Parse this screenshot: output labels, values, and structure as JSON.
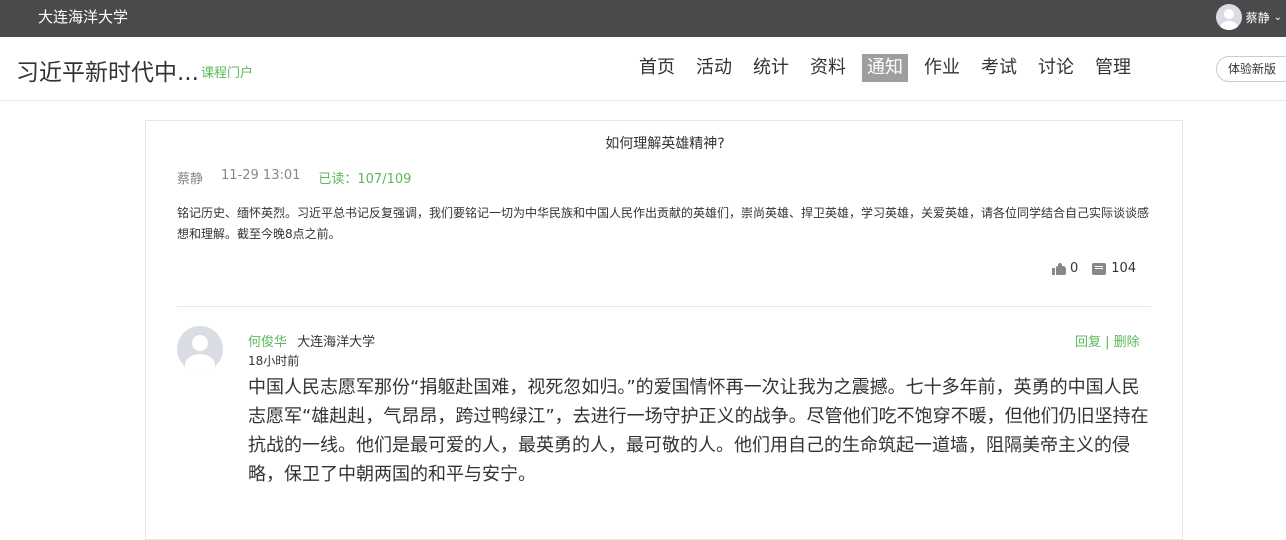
{
  "topbar": {
    "school_name": "大连海洋大学",
    "user_name": "蔡静",
    "dropdown_glyph": "⌄"
  },
  "nav": {
    "course_title": "习近平新时代中...",
    "course_portal": "课程门户",
    "menu": [
      {
        "label": "首页",
        "active": false
      },
      {
        "label": "活动",
        "active": false
      },
      {
        "label": "统计",
        "active": false
      },
      {
        "label": "资料",
        "active": false
      },
      {
        "label": "通知",
        "active": true
      },
      {
        "label": "作业",
        "active": false
      },
      {
        "label": "考试",
        "active": false
      },
      {
        "label": "讨论",
        "active": false
      },
      {
        "label": "管理",
        "active": false
      }
    ],
    "trial_button": "体验新版"
  },
  "notice": {
    "title": "如何理解英雄精神?",
    "author": "蔡静",
    "time": "11-29 13:01",
    "read_status": "已读：107/109",
    "body": "铭记历史、缅怀英烈。习近平总书记反复强调，我们要铭记一切为中华民族和中国人民作出贡献的英雄们，崇尚英雄、捍卫英雄，学习英雄，关爱英雄，请各位同学结合自己实际谈谈感想和理解。截至今晚8点之前。",
    "likes": "0",
    "comments": "104"
  },
  "reply": {
    "author": "何俊华",
    "school": "大连海洋大学",
    "time": "18小时前",
    "actions": "回复 | 删除",
    "text": "中国人民志愿军那份“捐躯赴国难，视死忽如归。”的爱国情怀再一次让我为之震撼。七十多年前，英勇的中国人民志愿军“雄赳赳，气昂昂，跨过鸭绿江”，去进行一场守护正义的战争。尽管他们吃不饱穿不暖，但他们仍旧坚持在抗战的一线。他们是最可爱的人，最英勇的人，最可敬的人。他们用自己的生命筑起一道墙，阻隔美帝主义的侵略，保卫了中朝两国的和平与安宁。"
  },
  "colors": {
    "topbar": "#4a4a4a",
    "accent_green": "#5cb85c",
    "active_tab": "#9e9e9e"
  }
}
